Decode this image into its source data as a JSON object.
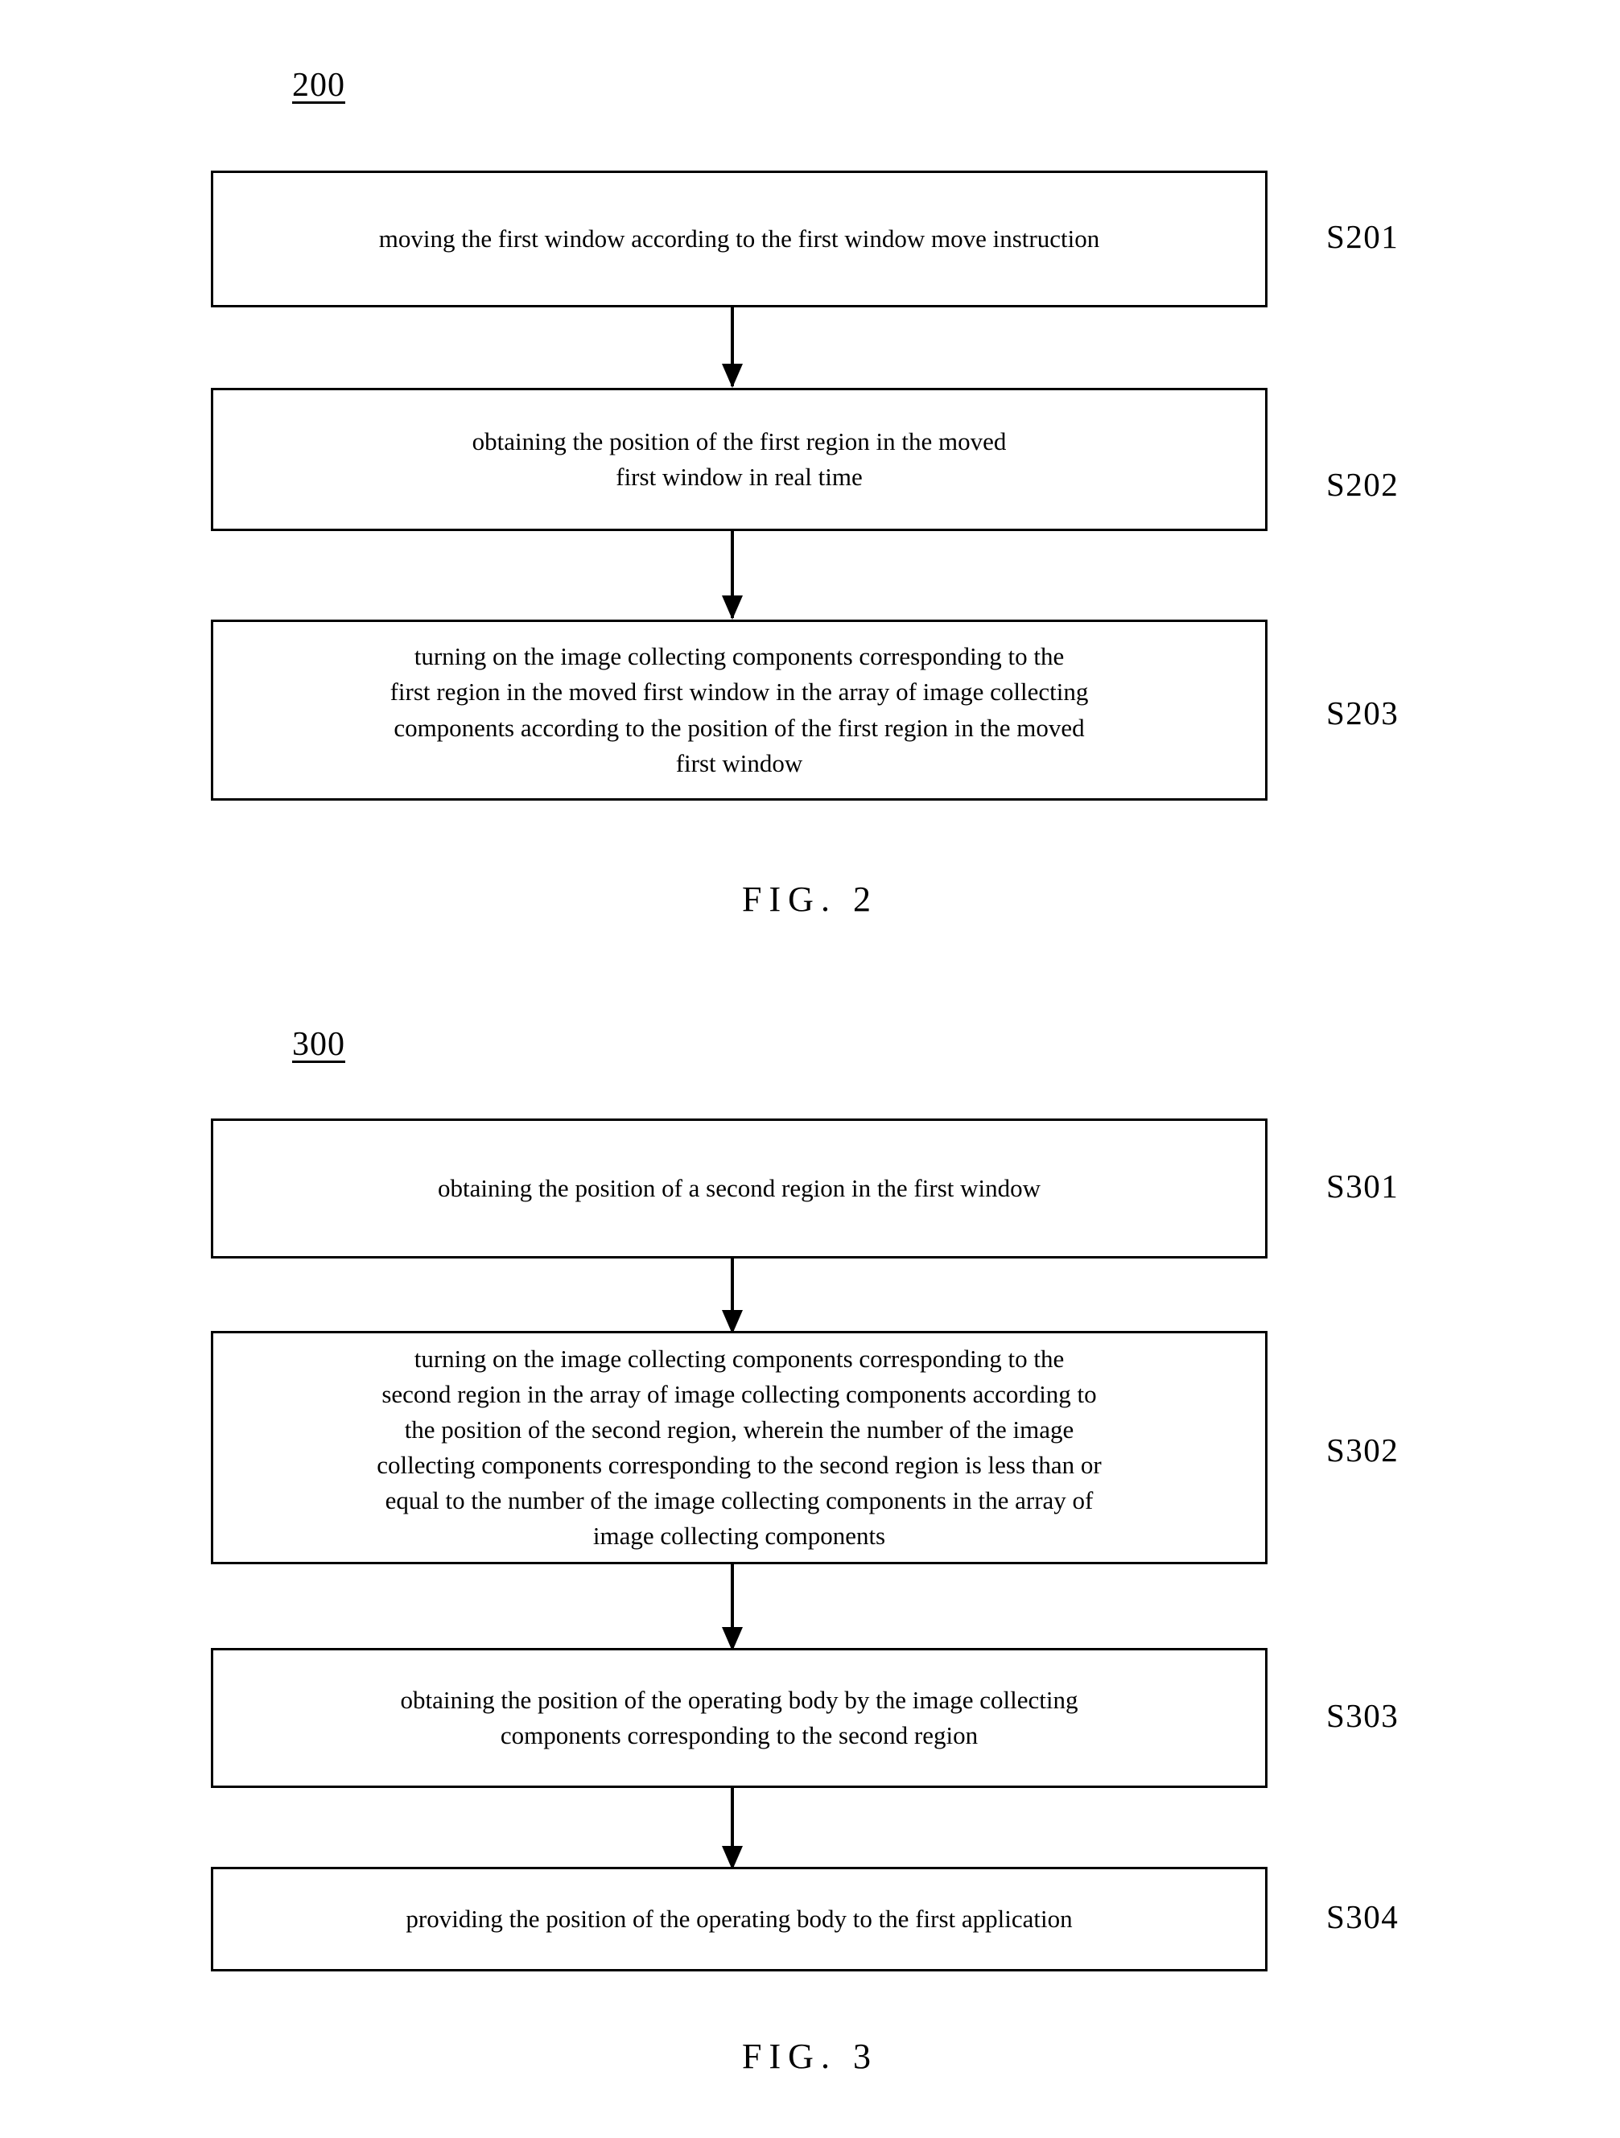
{
  "figures": [
    {
      "id": "fig-2",
      "reference_numeral": "200",
      "caption": "FIG. 2",
      "steps": [
        {
          "label": "S201",
          "text": "moving the first window according to the first window move instruction"
        },
        {
          "label": "S202",
          "text": "obtaining the position of the first region in the moved\nfirst window in real time"
        },
        {
          "label": "S203",
          "text": "turning on the image collecting components corresponding to the\nfirst region in the moved first window in the array of image collecting\ncomponents according to the position of the first region in the moved\nfirst window"
        }
      ]
    },
    {
      "id": "fig-3",
      "reference_numeral": "300",
      "caption": "FIG. 3",
      "steps": [
        {
          "label": "S301",
          "text": "obtaining the position of a second region in the first window"
        },
        {
          "label": "S302",
          "text": "turning on the image collecting components corresponding to the\nsecond region in the array of image collecting components according to\nthe position of the second region, wherein the number of the image\ncollecting components corresponding to the second region is less than or\nequal to the number of the image collecting components in the array of\nimage collecting components"
        },
        {
          "label": "S303",
          "text": "obtaining the position of the operating body by the image collecting\ncomponents corresponding to the second region"
        },
        {
          "label": "S304",
          "text": "providing the position of the operating body to the first application"
        }
      ]
    }
  ],
  "colors": {
    "ink": "#000000",
    "paper": "#ffffff"
  }
}
